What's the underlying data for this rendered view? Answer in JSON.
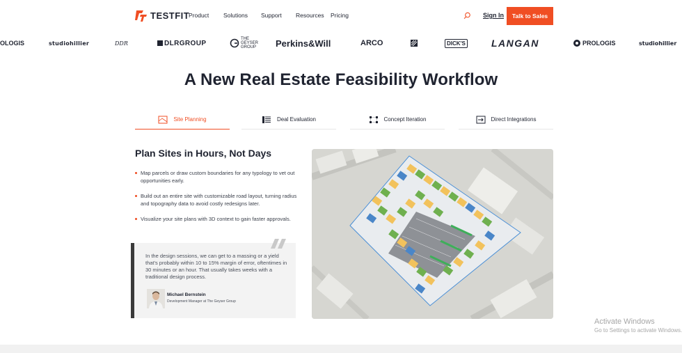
{
  "nav": {
    "logo_text": "TESTFIT",
    "links": [
      "Product",
      "Solutions",
      "Support",
      "Resources",
      "Pricing"
    ],
    "signin_label": "Sign In",
    "cta_label": "Talk to Sales"
  },
  "logos": [
    "OLOGIS",
    "studiohillier",
    "DDR",
    "DLRGROUP",
    "THE GEYSER GROUP",
    "Perkins&Will",
    "ARCO",
    "",
    "DICK'S",
    "LANGAN",
    "PROLOGIS",
    "studiohillier"
  ],
  "headline": "A New Real Estate Feasibility Workflow",
  "tabs": [
    {
      "label": "Site Planning",
      "icon": "parcel-icon",
      "active": true
    },
    {
      "label": "Deal Evaluation",
      "icon": "list-icon",
      "active": false
    },
    {
      "label": "Concept Iteration",
      "icon": "grid-icon",
      "active": false
    },
    {
      "label": "Direct Integrations",
      "icon": "integration-icon",
      "active": false
    }
  ],
  "section": {
    "title": "Plan Sites in Hours, Not Days",
    "bullets": [
      "Map parcels or draw custom boundaries for any typology to vet out opportunities early.",
      "Build out an entire site with customizable road layout, turning radius and topography data to avoid costly redesigns later.",
      "Visualize your site plans with 3D context to gain faster approvals."
    ]
  },
  "quote": {
    "text": "In the design sessions, we can get to a massing or a yield that's probably within 10 to 15% margin of error, oftentimes in 30 minutes or an hour. That usually takes weeks with a traditional design process.",
    "name": "Michael Bernstein",
    "role": "Development Manager at The Geyser Group"
  },
  "watermark": {
    "title": "Activate Windows",
    "subtitle": "Go to Settings to activate Windows."
  },
  "colors": {
    "accent": "#f04e23",
    "text": "#1f2330"
  }
}
